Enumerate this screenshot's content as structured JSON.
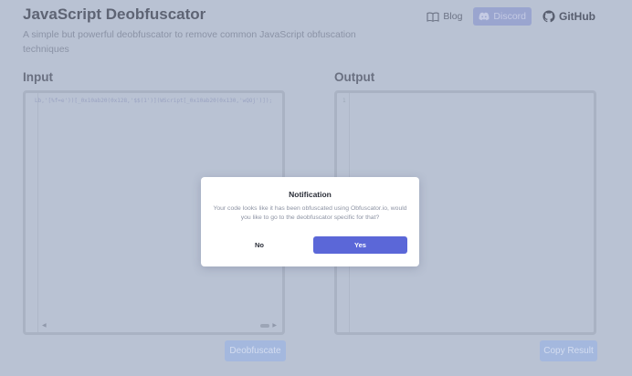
{
  "header": {
    "title": "JavaScript Deobfuscator",
    "subtitle": "A simple but powerful deobfuscator to remove common JavaScript obfuscation techniques"
  },
  "nav": {
    "blog_label": "Blog",
    "discord_label": "Discord",
    "github_label": "GitHub"
  },
  "input": {
    "label": "Input",
    "code_line": "Lb,'[%f=e'))[_0x10ab20(0x128,'$$(1')](WScript[_0x10ab20(0x130,'wQOj')]);",
    "button_label": "Deobfuscate"
  },
  "output": {
    "label": "Output",
    "line_number": "1",
    "button_label": "Copy Result"
  },
  "modal": {
    "title": "Notification",
    "message": "Your code looks like it has been obfuscated using Obfuscator.io, would you like to go to the deobfuscator specific for that?",
    "no_label": "No",
    "yes_label": "Yes"
  },
  "colors": {
    "accent": "#5b67d8",
    "background": "#b9c2d3",
    "discord_bg": "#9aa5cf",
    "action_button_bg": "#a4b8de"
  },
  "icons": {
    "blog": "book-icon",
    "discord": "discord-icon",
    "github": "github-icon"
  }
}
